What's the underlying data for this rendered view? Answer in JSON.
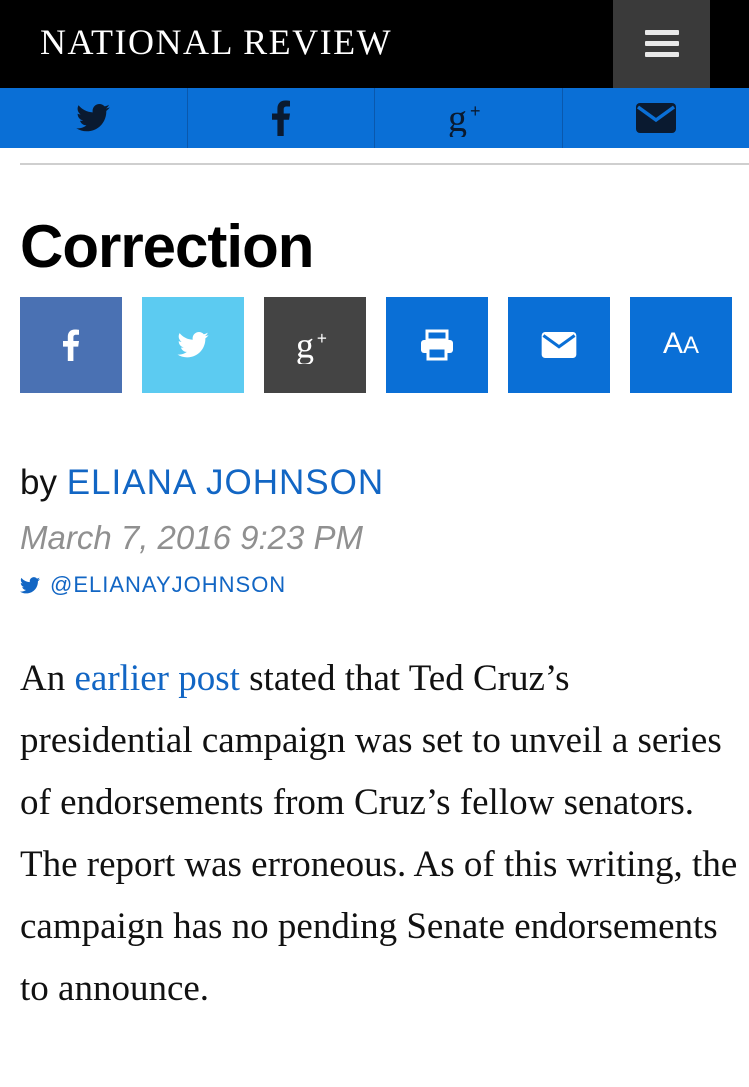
{
  "header": {
    "brand": "NATIONAL REVIEW",
    "menu_icon": "hamburger-menu-icon"
  },
  "share_bar": {
    "items": [
      {
        "icon": "twitter-icon"
      },
      {
        "icon": "facebook-icon"
      },
      {
        "icon": "google-plus-icon"
      },
      {
        "icon": "envelope-icon"
      }
    ],
    "color": "#0a6fd6"
  },
  "article": {
    "title": "Correction",
    "actions": [
      {
        "icon": "facebook-icon",
        "color": "#4a71b3"
      },
      {
        "icon": "twitter-icon",
        "color": "#5ccbf1"
      },
      {
        "icon": "google-plus-icon",
        "color": "#444444"
      },
      {
        "icon": "print-icon",
        "color": "#0a6fd6"
      },
      {
        "icon": "envelope-icon",
        "color": "#0a6fd6"
      },
      {
        "icon": "text-size-icon",
        "label": "AA",
        "color": "#0a6fd6"
      }
    ],
    "byline_prefix": "by",
    "author": "ELIANA JOHNSON",
    "date": "March 7, 2016 9:23 PM",
    "twitter_handle": "@ELIANAYJOHNSON",
    "body_prefix": "An",
    "body_link": "earlier post",
    "body_rest": "stated that Ted Cruz’s presidential campaign was set to unveil a series of endorsements from Cruz’s fellow senators. The report was erroneous. As of this writing, the campaign has no pending Senate endorsements to announce."
  }
}
